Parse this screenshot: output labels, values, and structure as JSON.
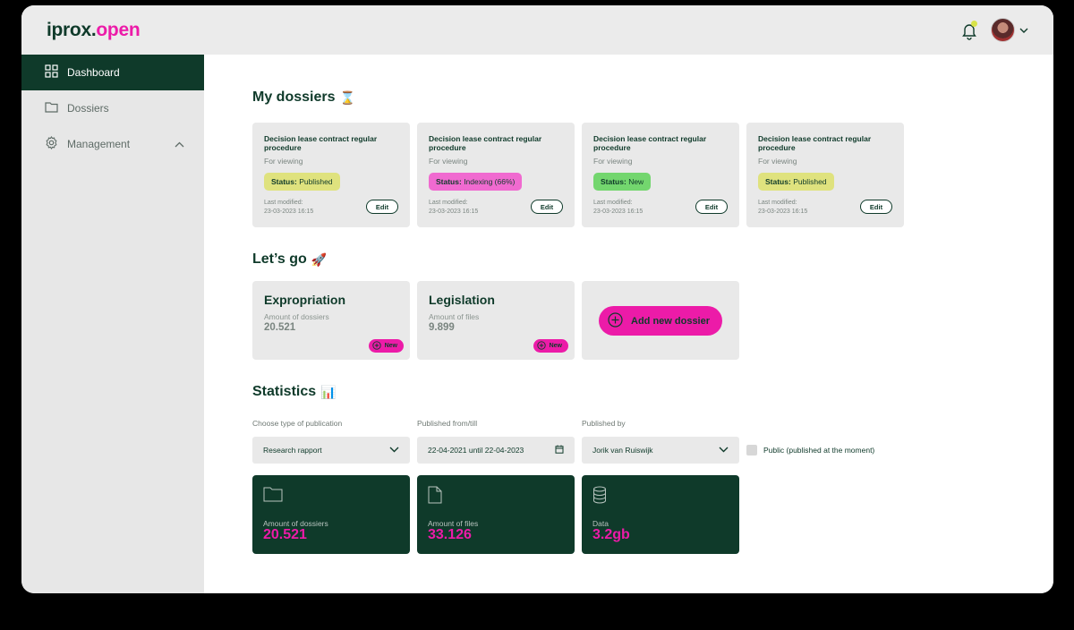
{
  "brand": {
    "logo_dark": "iprox.",
    "logo_pink": "open"
  },
  "colors": {
    "primary": "#0f3a2a",
    "accent": "#ec1ba8",
    "published": "#dfe27e",
    "indexing": "#f06ad0",
    "new": "#73d66e"
  },
  "sidebar": {
    "items": [
      {
        "label": "Dashboard",
        "icon": "grid-icon",
        "active": true
      },
      {
        "label": "Dossiers",
        "icon": "folder-icon"
      },
      {
        "label": "Management",
        "icon": "gear-icon",
        "expanded": true
      }
    ]
  },
  "my_dossiers": {
    "title": "My dossiers",
    "emoji": "⌛",
    "cards": [
      {
        "title": "Decision lease contract regular procedure",
        "subtitle": "For viewing",
        "status_label": "Status:",
        "status": "Published",
        "modified_label": "Last modified:",
        "modified": "23-03-2023 16:15",
        "edit": "Edit"
      },
      {
        "title": "Decision lease contract regular procedure",
        "subtitle": "For viewing",
        "status_label": "Status:",
        "status": "Indexing (66%)",
        "modified_label": "Last modified:",
        "modified": "23-03-2023 16:15",
        "edit": "Edit"
      },
      {
        "title": "Decision lease contract regular procedure",
        "subtitle": "For viewing",
        "status_label": "Status:",
        "status": "New",
        "modified_label": "Last modified:",
        "modified": "23-03-2023 16:15",
        "edit": "Edit"
      },
      {
        "title": "Decision lease contract regular procedure",
        "subtitle": "For viewing",
        "status_label": "Status:",
        "status": "Published",
        "modified_label": "Last modified:",
        "modified": "23-03-2023 16:15",
        "edit": "Edit"
      }
    ]
  },
  "lets_go": {
    "title": "Let’s go",
    "emoji": "🚀",
    "cards": [
      {
        "title": "Expropriation",
        "label": "Amount of dossiers",
        "value": "20.521",
        "new_label": "New"
      },
      {
        "title": "Legislation",
        "label": "Amount of files",
        "value": "9.899",
        "new_label": "New"
      }
    ],
    "add_label": "Add new dossier"
  },
  "statistics": {
    "title": "Statistics",
    "emoji": "📊",
    "filters": {
      "type_label": "Choose type of publication",
      "type_value": "Research rapport",
      "date_label": "Published from/till",
      "date_value": "22-04-2021 until 22-04-2023",
      "by_label": "Published by",
      "by_value": "Jorik van Ruiswijk",
      "public_label": "Public (published at the moment)"
    },
    "cards": [
      {
        "label": "Amount of dossiers",
        "value": "20.521",
        "icon": "folder-icon"
      },
      {
        "label": "Amount of files",
        "value": "33.126",
        "icon": "file-icon"
      },
      {
        "label": "Data",
        "value": "3.2gb",
        "icon": "database-icon"
      }
    ]
  }
}
